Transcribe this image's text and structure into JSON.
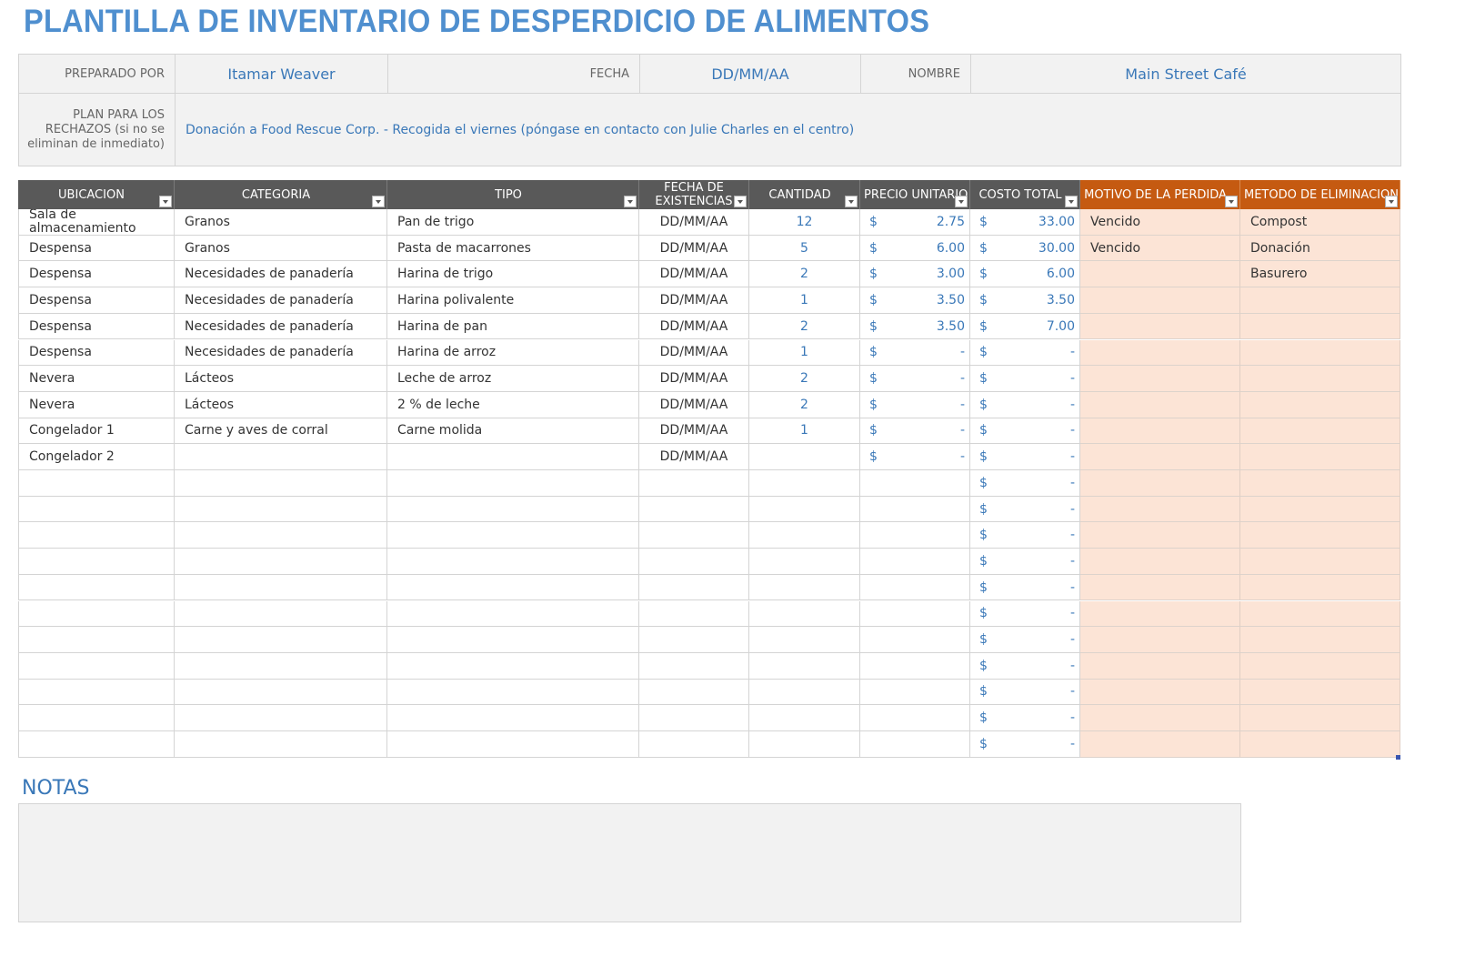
{
  "title": "PLANTILLA DE INVENTARIO DE DESPERDICIO DE ALIMENTOS",
  "info": {
    "prepared_by_label": "PREPARADO POR",
    "prepared_by_value": "Itamar Weaver",
    "date_label": "FECHA",
    "date_value": "DD/MM/AA",
    "name_label": "NOMBRE",
    "name_value": "Main Street Café",
    "plan_label": "PLAN PARA LOS RECHAZOS (si no se eliminan de inmediato)",
    "plan_value": "Donación a Food Rescue Corp. - Recogida el viernes (póngase en contacto con Julie Charles en el centro)"
  },
  "table": {
    "headers": [
      "UBICACIÓN",
      "CATEGORÍA",
      "TIPO",
      "FECHA DE EXISTENCIAS",
      "CANTIDAD",
      "PRECIO UNITARIO",
      "COSTO TOTAL",
      "MOTIVO DE LA PÉRDIDA",
      "MÉTODO DE ELIMINACIÓN"
    ],
    "currency_symbol": "$",
    "rows": [
      {
        "ubicacion": "Sala de almacenamiento",
        "categoria": "Granos",
        "tipo": "Pan de trigo",
        "fecha": "DD/MM/AA",
        "cantidad": "12",
        "precio": "2.75",
        "costo": "33.00",
        "motivo": "Vencido",
        "metodo": "Compost"
      },
      {
        "ubicacion": "Despensa",
        "categoria": "Granos",
        "tipo": "Pasta de macarrones",
        "fecha": "DD/MM/AA",
        "cantidad": "5",
        "precio": "6.00",
        "costo": "30.00",
        "motivo": "Vencido",
        "metodo": "Donación"
      },
      {
        "ubicacion": "Despensa",
        "categoria": "Necesidades de panadería",
        "tipo": "Harina de trigo",
        "fecha": "DD/MM/AA",
        "cantidad": "2",
        "precio": "3.00",
        "costo": "6.00",
        "motivo": "",
        "metodo": "Basurero"
      },
      {
        "ubicacion": "Despensa",
        "categoria": "Necesidades de panadería",
        "tipo": "Harina polivalente",
        "fecha": "DD/MM/AA",
        "cantidad": "1",
        "precio": "3.50",
        "costo": "3.50",
        "motivo": "",
        "metodo": ""
      },
      {
        "ubicacion": "Despensa",
        "categoria": "Necesidades de panadería",
        "tipo": "Harina de pan",
        "fecha": "DD/MM/AA",
        "cantidad": "2",
        "precio": "3.50",
        "costo": "7.00",
        "motivo": "",
        "metodo": ""
      },
      {
        "ubicacion": "Despensa",
        "categoria": "Necesidades de panadería",
        "tipo": "Harina de arroz",
        "fecha": "DD/MM/AA",
        "cantidad": "1",
        "precio": "-",
        "costo": "-",
        "motivo": "",
        "metodo": ""
      },
      {
        "ubicacion": "Nevera",
        "categoria": "Lácteos",
        "tipo": "Leche de arroz",
        "fecha": "DD/MM/AA",
        "cantidad": "2",
        "precio": "-",
        "costo": "-",
        "motivo": "",
        "metodo": ""
      },
      {
        "ubicacion": "Nevera",
        "categoria": "Lácteos",
        "tipo": "2 % de leche",
        "fecha": "DD/MM/AA",
        "cantidad": "2",
        "precio": "-",
        "costo": "-",
        "motivo": "",
        "metodo": ""
      },
      {
        "ubicacion": "Congelador 1",
        "categoria": "Carne y aves de corral",
        "tipo": "Carne molida",
        "fecha": "DD/MM/AA",
        "cantidad": "1",
        "precio": "-",
        "costo": "-",
        "motivo": "",
        "metodo": ""
      },
      {
        "ubicacion": "Congelador 2",
        "categoria": "",
        "tipo": "",
        "fecha": "DD/MM/AA",
        "cantidad": "",
        "precio": "-",
        "costo": "-",
        "motivo": "",
        "metodo": ""
      },
      {
        "ubicacion": "",
        "categoria": "",
        "tipo": "",
        "fecha": "",
        "cantidad": "",
        "precio": null,
        "costo": "-",
        "motivo": "",
        "metodo": ""
      },
      {
        "ubicacion": "",
        "categoria": "",
        "tipo": "",
        "fecha": "",
        "cantidad": "",
        "precio": null,
        "costo": "-",
        "motivo": "",
        "metodo": ""
      },
      {
        "ubicacion": "",
        "categoria": "",
        "tipo": "",
        "fecha": "",
        "cantidad": "",
        "precio": null,
        "costo": "-",
        "motivo": "",
        "metodo": ""
      },
      {
        "ubicacion": "",
        "categoria": "",
        "tipo": "",
        "fecha": "",
        "cantidad": "",
        "precio": null,
        "costo": "-",
        "motivo": "",
        "metodo": ""
      },
      {
        "ubicacion": "",
        "categoria": "",
        "tipo": "",
        "fecha": "",
        "cantidad": "",
        "precio": null,
        "costo": "-",
        "motivo": "",
        "metodo": ""
      },
      {
        "ubicacion": "",
        "categoria": "",
        "tipo": "",
        "fecha": "",
        "cantidad": "",
        "precio": null,
        "costo": "-",
        "motivo": "",
        "metodo": ""
      },
      {
        "ubicacion": "",
        "categoria": "",
        "tipo": "",
        "fecha": "",
        "cantidad": "",
        "precio": null,
        "costo": "-",
        "motivo": "",
        "metodo": ""
      },
      {
        "ubicacion": "",
        "categoria": "",
        "tipo": "",
        "fecha": "",
        "cantidad": "",
        "precio": null,
        "costo": "-",
        "motivo": "",
        "metodo": ""
      },
      {
        "ubicacion": "",
        "categoria": "",
        "tipo": "",
        "fecha": "",
        "cantidad": "",
        "precio": null,
        "costo": "-",
        "motivo": "",
        "metodo": ""
      },
      {
        "ubicacion": "",
        "categoria": "",
        "tipo": "",
        "fecha": "",
        "cantidad": "",
        "precio": null,
        "costo": "-",
        "motivo": "",
        "metodo": ""
      },
      {
        "ubicacion": "",
        "categoria": "",
        "tipo": "",
        "fecha": "",
        "cantidad": "",
        "precio": null,
        "costo": "-",
        "motivo": "",
        "metodo": ""
      }
    ]
  },
  "notes": {
    "title": "NOTAS",
    "content": ""
  },
  "colors": {
    "title_blue": "#4f8fcf",
    "header_dark": "#595959",
    "header_orange": "#c55a11",
    "orange_fill": "#fce4d6",
    "value_blue": "#3a78b8",
    "panel_gray": "#f2f2f2"
  }
}
